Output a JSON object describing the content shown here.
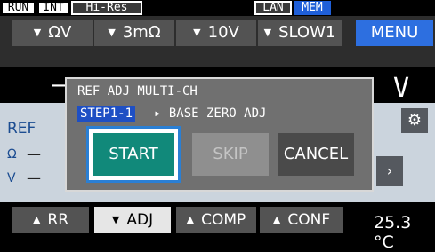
{
  "status_bar": {
    "run": "RUN",
    "int": "INT",
    "hires": "Hi-Res",
    "lan": "LAN",
    "mem": "MEM"
  },
  "top_buttons": {
    "function": "ΩV",
    "resistance_range": "3mΩ",
    "voltage_range": "10V",
    "speed": "SLOW1",
    "menu": "MENU"
  },
  "measurement": {
    "left_dash": "–",
    "unit": "V"
  },
  "panel": {
    "ref_label": "REF",
    "ohm_label": "Ω",
    "volt_label": "V",
    "dash1": "—",
    "dash2": "—"
  },
  "dialog": {
    "title": "REF ADJ MULTI-CH",
    "step_badge": "STEP1-1",
    "step_description": "▸ BASE ZERO ADJ",
    "start_label": "START",
    "skip_label": "SKIP",
    "cancel_label": "CANCEL"
  },
  "bottom_buttons": {
    "rr": "RR",
    "adj": "ADJ",
    "comp": "COMP",
    "conf": "CONF"
  },
  "temperature": "25.3 °C",
  "icons": {
    "triangle_down": "▼",
    "triangle_up": "▲",
    "gear": "⚙",
    "arrow_right": "›"
  },
  "colors": {
    "menu_blue": "#2d6fe0",
    "start_teal": "#11897a",
    "step_blue": "#1e4fc4",
    "mem_blue": "#1f5fd8"
  }
}
